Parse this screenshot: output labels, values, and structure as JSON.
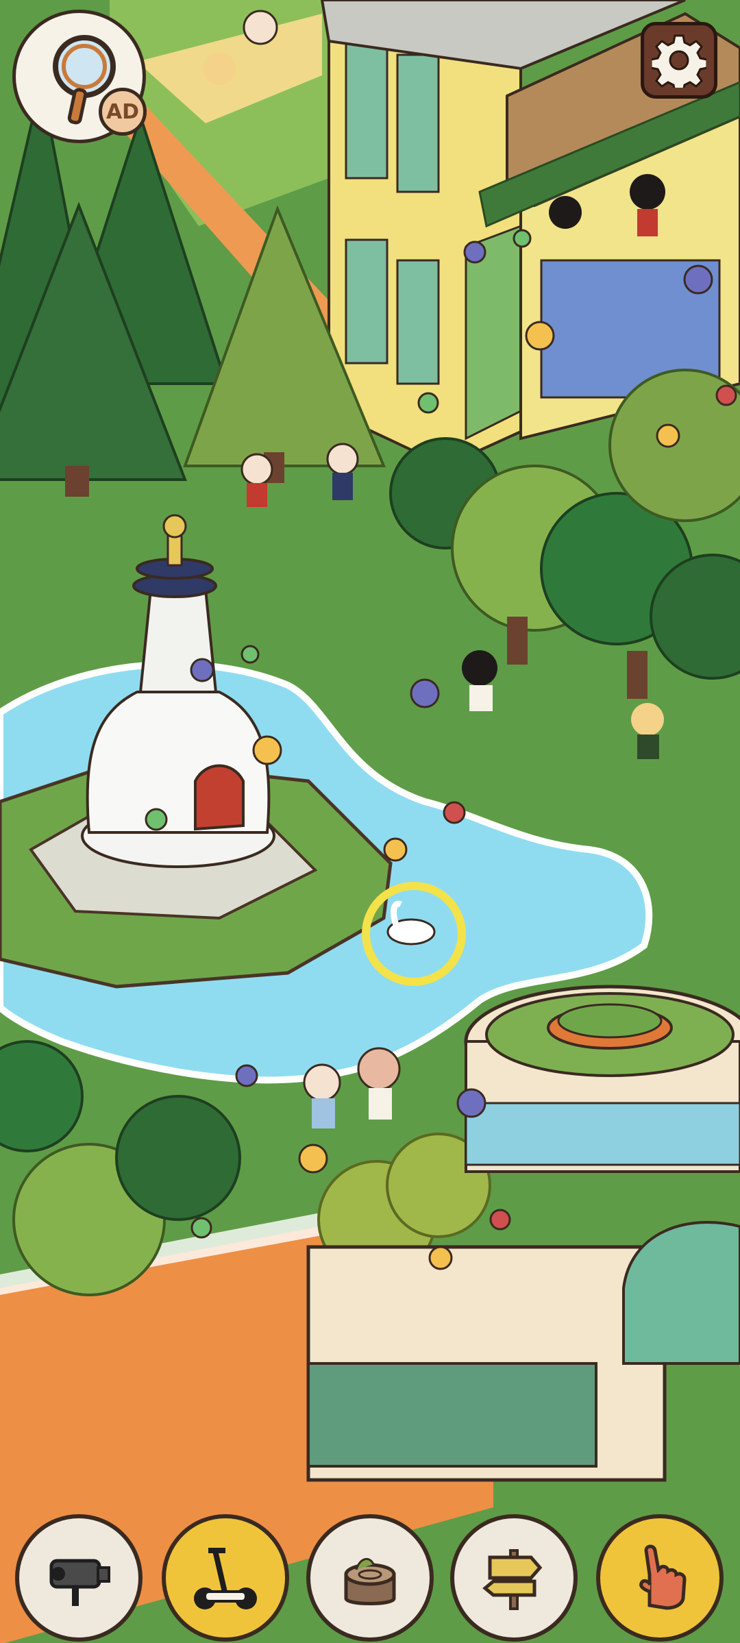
{
  "hud": {
    "hint_badge": "AD"
  },
  "toolbar": {
    "tools": [
      {
        "icon": "security-camera-icon"
      },
      {
        "icon": "segway-icon"
      },
      {
        "icon": "tree-stump-icon"
      },
      {
        "icon": "signpost-icon"
      },
      {
        "icon": "pointing-hand-icon"
      }
    ]
  },
  "colors": {
    "grass": "#5f9c47",
    "water": "#8fdcf0",
    "highlight_ring": "#f4e24a",
    "tool_gold": "#f0c43a",
    "tool_gray": "#efe9dd"
  }
}
